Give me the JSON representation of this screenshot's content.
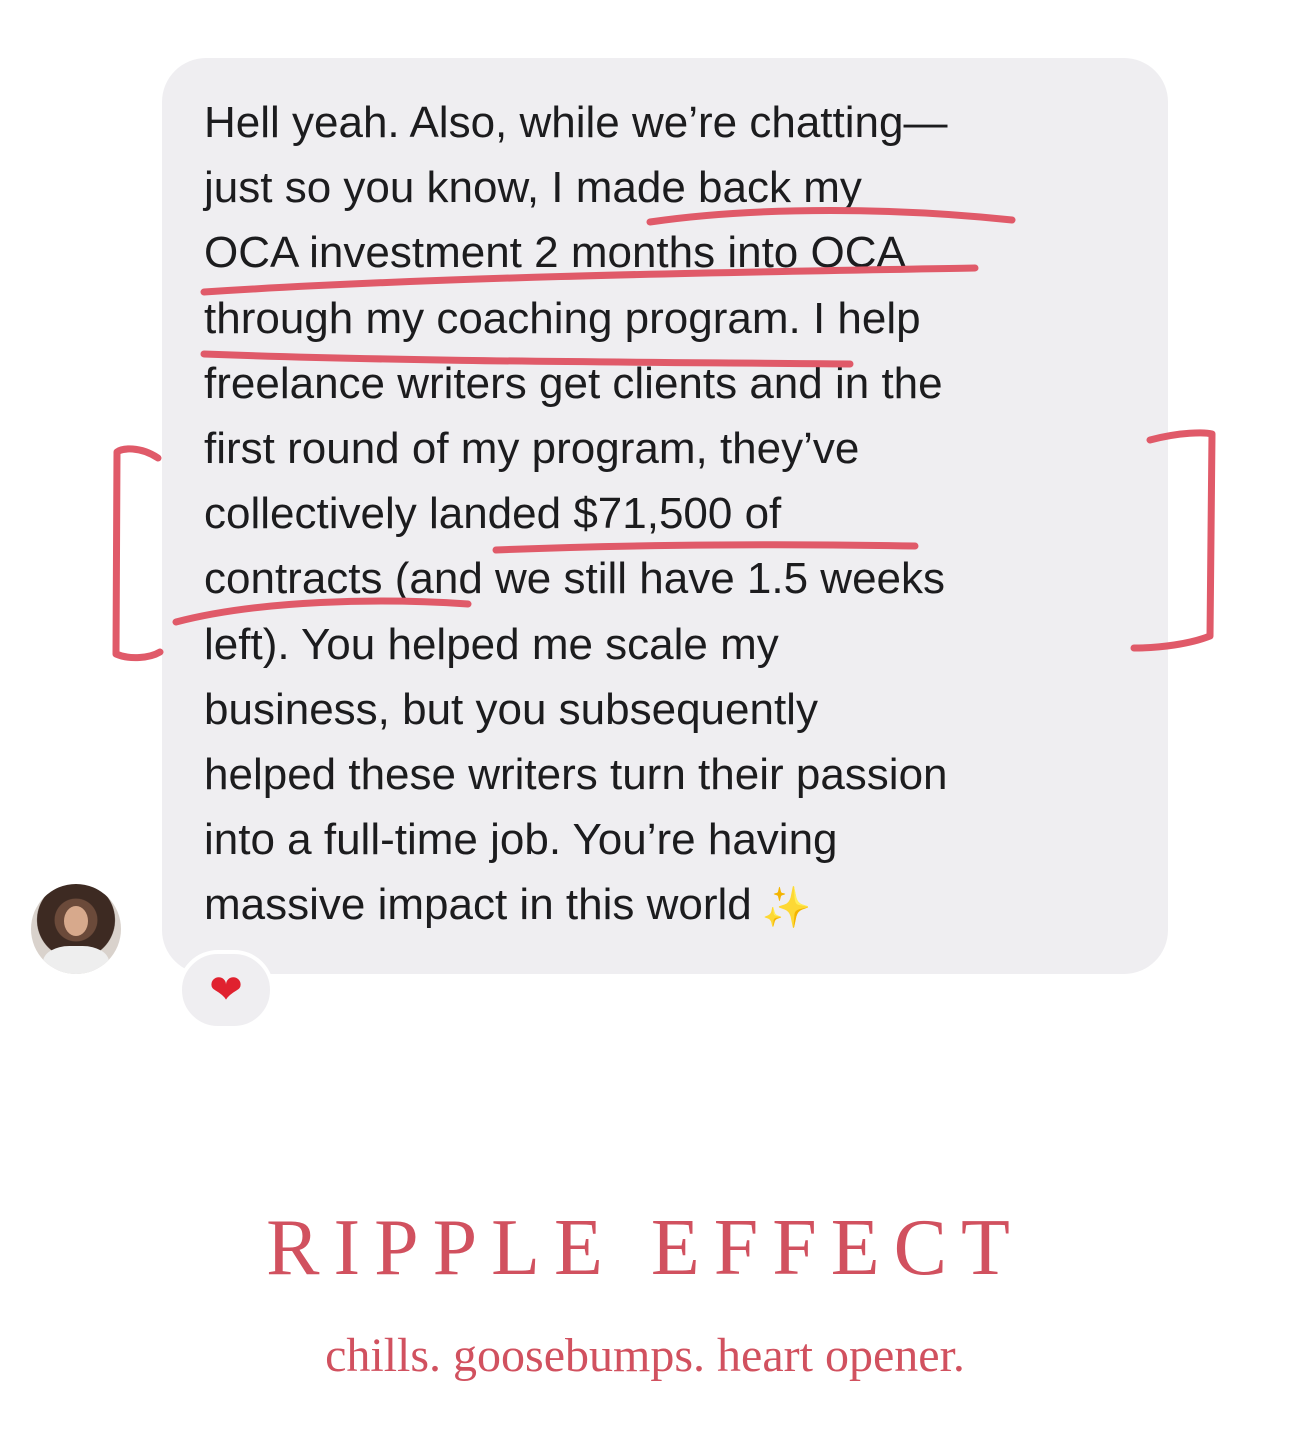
{
  "message": {
    "lines": [
      "Hell yeah. Also, while we’re chatting—",
      "just so you know, I made back my",
      "OCA investment 2 months into OCA",
      "through my coaching program. I help",
      "freelance writers get clients and in the",
      "first round of my program, they’ve",
      "collectively landed $71,500 of",
      "contracts (and we still have 1.5 weeks",
      "left). You helped me scale my",
      "business, but you subsequently",
      "helped these writers turn their passion",
      "into a full-time job. You’re having",
      "massive impact in this world"
    ],
    "end_emoji": "✨",
    "reaction_emoji": "❤"
  },
  "annotation_color": "#e05a69",
  "caption": {
    "headline": "RIPPLE EFFECT",
    "tagline": "chills. goosebumps. heart opener."
  },
  "colors": {
    "bubble": "#efeef1",
    "text": "#1c1c1e",
    "accent": "#d1515f"
  }
}
